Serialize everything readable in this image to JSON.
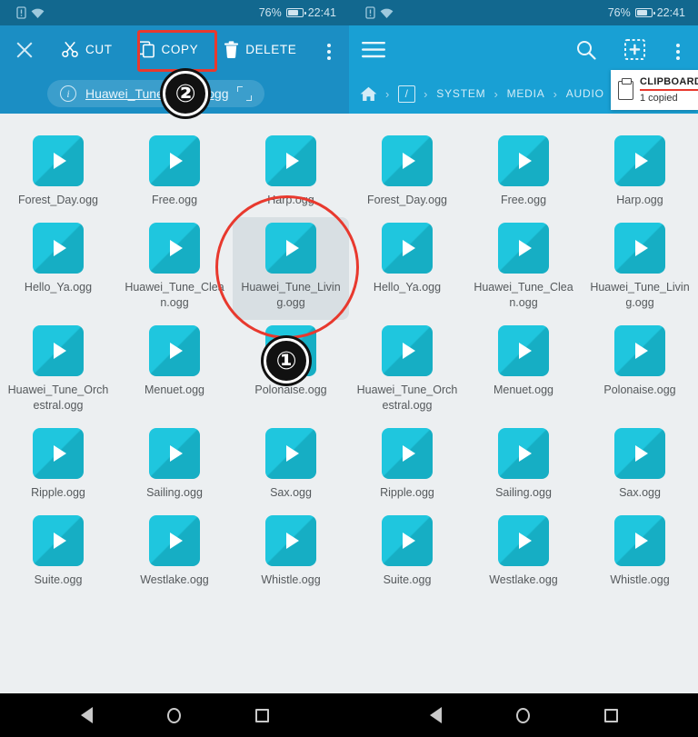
{
  "status_bar": {
    "battery_percent": "76%",
    "time": "22:41",
    "icons": [
      "sim-card-icon",
      "wifi-icon",
      "battery-icon"
    ]
  },
  "left_panel": {
    "toolbar": {
      "close_label": "close-icon",
      "cut_label": "CUT",
      "copy_label": "COPY",
      "delete_label": "DELETE",
      "overflow_label": "more-options-icon"
    },
    "info_bar": {
      "info_icon": "info-icon",
      "filename": "Huawei_Tune_Living.ogg",
      "expand_icon": "expand-icon"
    }
  },
  "right_panel": {
    "toolbar": {
      "menu_label": "hamburger-menu-icon",
      "search_label": "search-icon",
      "select_label": "multi-select-icon",
      "overflow_label": "more-options-icon"
    },
    "breadcrumb": {
      "home_icon": "home-icon",
      "root_label": "/",
      "items": [
        "SYSTEM",
        "MEDIA",
        "AUDIO"
      ]
    }
  },
  "clipboard_toast": {
    "icon": "clipboard-icon",
    "title": "CLIPBOARD",
    "subtitle": "1 copied",
    "underline_color": "#e8392e"
  },
  "files": [
    {
      "name": "Forest_Day.ogg",
      "selected": false
    },
    {
      "name": "Free.ogg",
      "selected": false
    },
    {
      "name": "Harp.ogg",
      "selected": false
    },
    {
      "name": "Hello_Ya.ogg",
      "selected": false
    },
    {
      "name": "Huawei_Tune_Clean.ogg",
      "selected": false
    },
    {
      "name": "Huawei_Tune_Living.ogg",
      "selected": false
    },
    {
      "name": "Huawei_Tune_Orchestral.ogg",
      "selected": false
    },
    {
      "name": "Menuet.ogg",
      "selected": false
    },
    {
      "name": "Polonaise.ogg",
      "selected": false
    },
    {
      "name": "Ripple.ogg",
      "selected": false
    },
    {
      "name": "Sailing.ogg",
      "selected": false
    },
    {
      "name": "Sax.ogg",
      "selected": false
    },
    {
      "name": "Suite.ogg",
      "selected": false
    },
    {
      "name": "Westlake.ogg",
      "selected": false
    },
    {
      "name": "Whistle.ogg",
      "selected": false
    }
  ],
  "left_selected_index": 5,
  "annotations": [
    {
      "label": "①",
      "shape": "circle",
      "target": "Huawei_Tune_Living.ogg"
    },
    {
      "label": "②",
      "shape": "rect",
      "target": "COPY"
    }
  ],
  "nav_bar": {
    "back": "back-icon",
    "home": "home-icon",
    "recents": "recents-icon"
  },
  "colors": {
    "status_bar": "#12688f",
    "toolbar_left": "#1b8ec4",
    "toolbar_right": "#19a0d4",
    "grid_bg": "#eceff1",
    "file_icon": "#1fc6de",
    "annotation": "#e8392e",
    "selection": "#d8dfe3"
  }
}
